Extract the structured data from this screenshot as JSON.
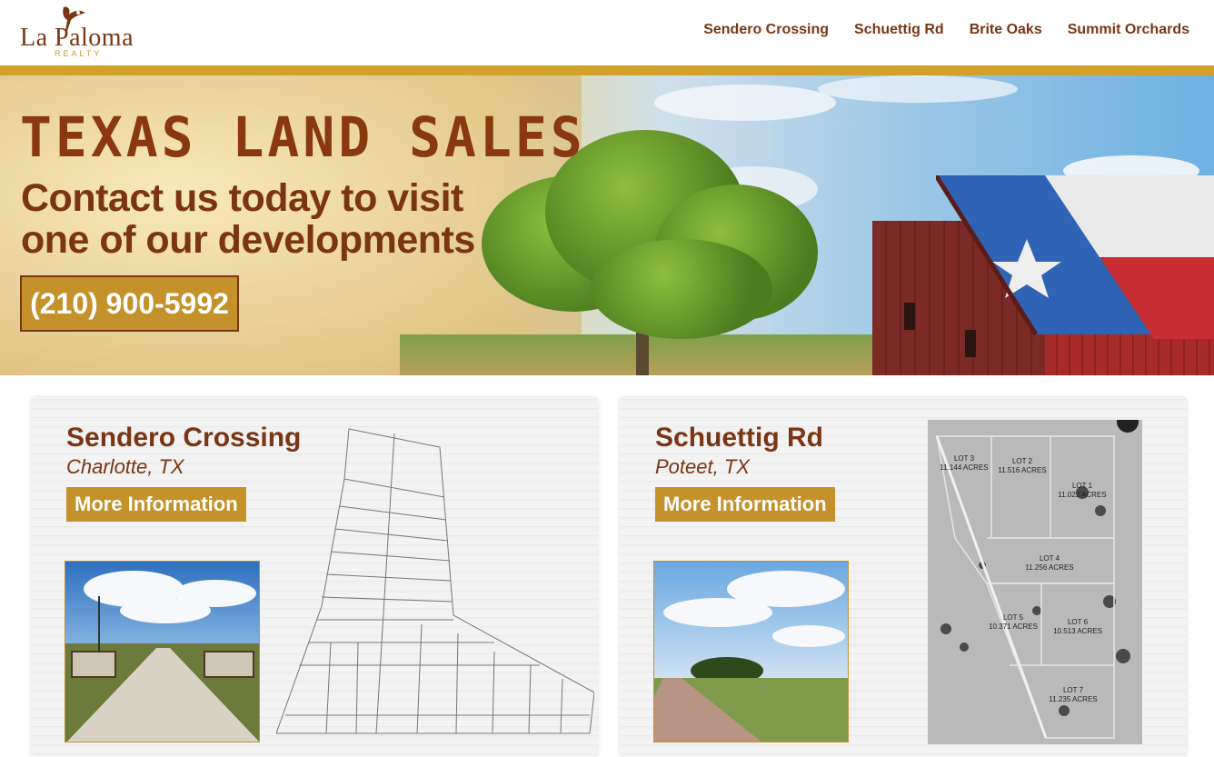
{
  "brand": {
    "name": "La Paloma",
    "sub": "REALTY"
  },
  "nav": [
    {
      "label": "Sendero Crossing"
    },
    {
      "label": "Schuettig Rd"
    },
    {
      "label": "Brite Oaks"
    },
    {
      "label": "Summit Orchards"
    }
  ],
  "hero": {
    "title": "TEXAS LAND SALES",
    "subtitle": "Contact us today to visit one of our developments",
    "phone": "(210) 900-5992"
  },
  "cards": [
    {
      "title": "Sendero Crossing",
      "location": "Charlotte, TX",
      "button": "More Information"
    },
    {
      "title": "Schuettig Rd",
      "location": "Poteet, TX",
      "button": "More Information"
    }
  ],
  "lots": [
    {
      "name": "LOT 3",
      "acres": "11.144 ACRES"
    },
    {
      "name": "LOT 2",
      "acres": "11.516 ACRES"
    },
    {
      "name": "LOT 1",
      "acres": "11.022 ACRES"
    },
    {
      "name": "LOT 4",
      "acres": "11.256 ACRES"
    },
    {
      "name": "LOT 5",
      "acres": "10.371 ACRES"
    },
    {
      "name": "LOT 6",
      "acres": "10.513 ACRES"
    },
    {
      "name": "LOT 7",
      "acres": "11.235 ACRES"
    }
  ],
  "colors": {
    "brand_brown": "#7b3512",
    "gold": "#d1a12a",
    "button_gold": "#c4912a"
  }
}
